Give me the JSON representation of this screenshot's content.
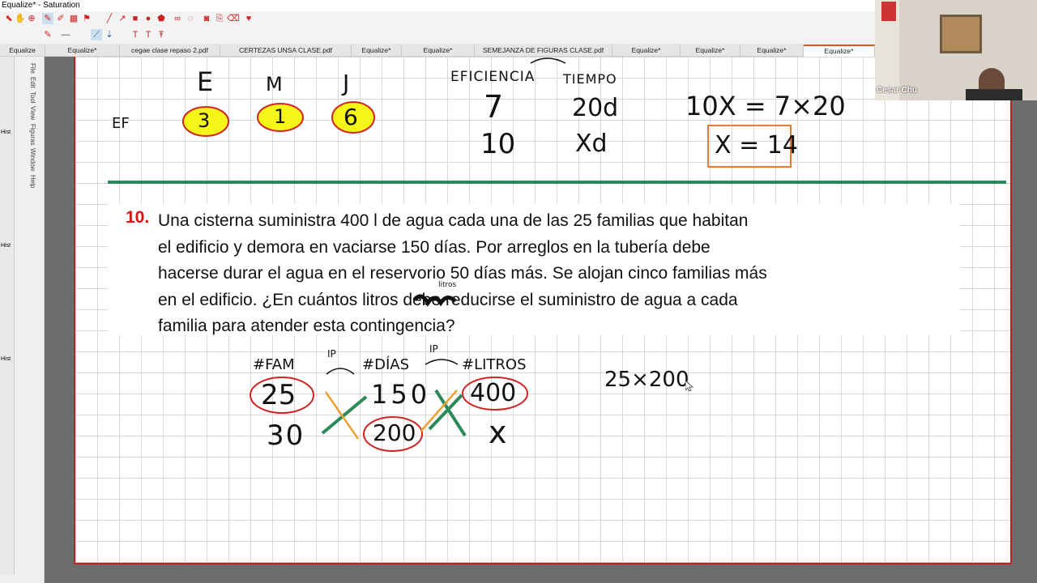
{
  "window": {
    "title": "Equalize* - Saturation"
  },
  "tabs": [
    "Equalize",
    "Equalize*",
    "cegae clase  repaso 2.pdf",
    "CERTEZAS UNSA CLASE.pdf",
    "Equalize*",
    "Equalize*",
    "SEMEJANZA DE FIGURAS CLASE.pdf",
    "Equalize*",
    "Equalize*",
    "Equalize*",
    "Equalize*"
  ],
  "active_tab": 10,
  "side_menu": [
    "File",
    "Edit",
    "Tool",
    "View",
    "Figuras",
    "Window",
    "Help"
  ],
  "side_labels": [
    "Hist",
    "Hist",
    "Hist"
  ],
  "video": {
    "name": "Cesar Chu"
  },
  "problem": {
    "number": "10.",
    "lines": [
      "Una cisterna suministra 400 l de agua cada una de las 25 familias que habitan",
      "el edificio y demora en vaciarse 150 días. Por arreglos en la tubería debe",
      "hacerse durar el agua en el reservorio 50 días más. Se alojan cinco familias más",
      "en el edificio. ¿En cuántos litros debe reducirse el suministro de agua a cada",
      "familia para atender esta contingencia?"
    ]
  },
  "notes_top": {
    "letters": [
      "E",
      "M",
      "J"
    ],
    "row_label": "EF",
    "values": [
      "3",
      "1",
      "6"
    ],
    "col1": "EFICIENCIA",
    "col2": "TIEMPO",
    "r1": [
      "7",
      "20d"
    ],
    "r2": [
      "10",
      "Xd"
    ],
    "eq1": "10X = 7×20",
    "eq2": "X = 14"
  },
  "notes_bottom": {
    "h1": "#FAM",
    "h2": "#DÍAS",
    "h3": "#LITROS",
    "ip1": "IP",
    "ip2": "IP",
    "r1": [
      "25",
      "150",
      "400"
    ],
    "r2": [
      "30",
      "200",
      "x"
    ],
    "calc": "25×200",
    "litros_note": "litros"
  },
  "colors": {
    "accent": "#d05a2a",
    "ink_red": "#d32222",
    "ink_green": "#2a8a5a",
    "ink_orange": "#f0a030",
    "highlight": "#f5f51a"
  }
}
